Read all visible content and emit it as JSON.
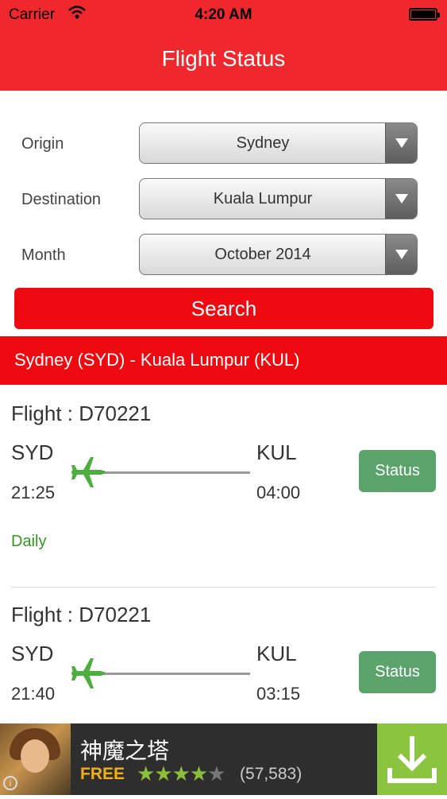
{
  "status_bar": {
    "carrier": "Carrier",
    "time": "4:20 AM"
  },
  "nav": {
    "title": "Flight Status"
  },
  "form": {
    "origin": {
      "label": "Origin",
      "value": "Sydney"
    },
    "destination": {
      "label": "Destination",
      "value": "Kuala Lumpur"
    },
    "month": {
      "label": "Month",
      "value": "October 2014"
    },
    "search_label": "Search"
  },
  "route_header": "Sydney (SYD) - Kuala Lumpur (KUL)",
  "flights": [
    {
      "flight": "Flight : D70221",
      "from": "SYD",
      "to": "KUL",
      "dep": "21:25",
      "arr": "04:00",
      "status_label": "Status",
      "frequency": "Daily"
    },
    {
      "flight": "Flight : D70221",
      "from": "SYD",
      "to": "KUL",
      "dep": "21:40",
      "arr": "03:15",
      "status_label": "Status"
    }
  ],
  "ad": {
    "name": "神魔之塔",
    "price": "FREE",
    "stars": "★★★★",
    "stars_dim": "★",
    "rating_count": "(57,583)"
  },
  "colors": {
    "brand_red": "#f0282d",
    "status_green": "#5aa36b",
    "frequency_green": "#2f9a1c",
    "download_green": "#8bc53f"
  },
  "icons": [
    "wifi-icon",
    "battery-icon",
    "dropdown-arrow-icon",
    "airplane-icon",
    "info-icon",
    "download-icon"
  ]
}
